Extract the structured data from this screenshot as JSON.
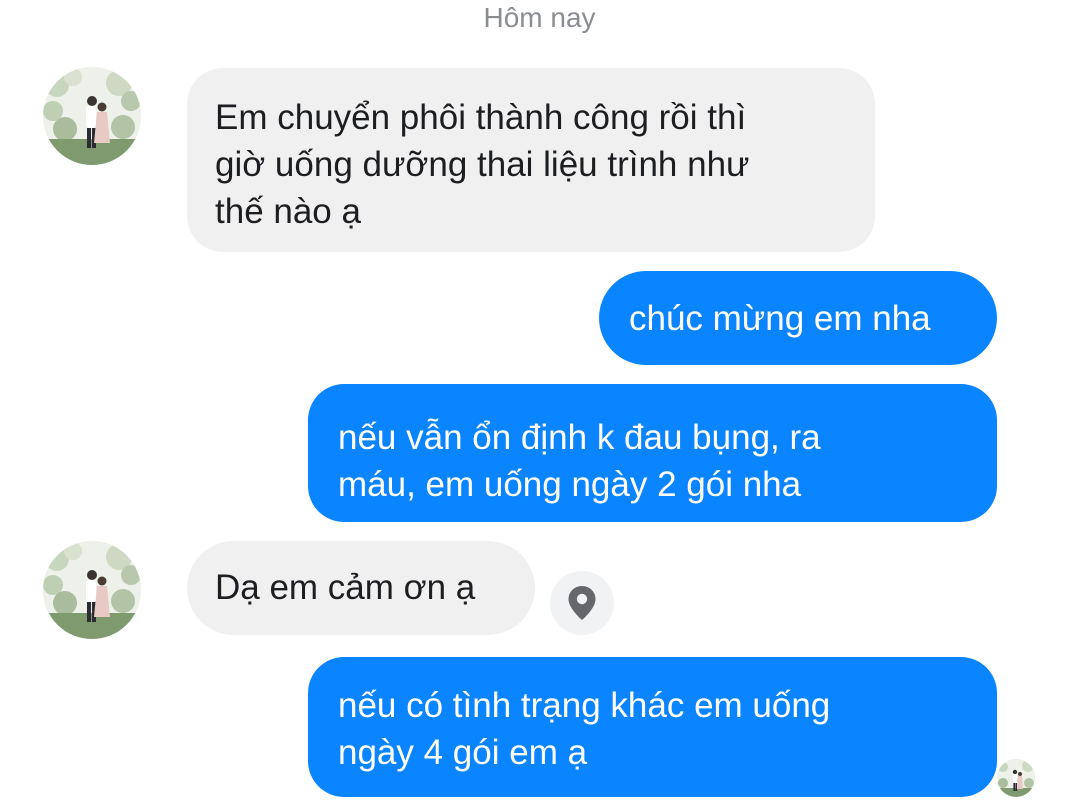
{
  "date_separator": "Hôm nay",
  "messages": [
    {
      "direction": "incoming",
      "text": "Em chuyển phôi thành công rồi thì\ngiờ uống dưỡng thai liệu trình như\nthế nào ạ"
    },
    {
      "direction": "outgoing",
      "text": "chúc mừng em nha"
    },
    {
      "direction": "outgoing",
      "text": "nếu vẫn ổn định k đau bụng, ra\nmáu, em uống ngày 2 gói nha"
    },
    {
      "direction": "incoming",
      "text": "Dạ em cảm ơn ạ"
    },
    {
      "direction": "outgoing",
      "text": "nếu có tình trạng khác em uống\nngày 4 gói em ạ"
    }
  ],
  "icons": {
    "contact_avatar": "avatar-photo-icon",
    "location": "location-pin-icon",
    "seen_indicator": "seen-avatar-icon"
  },
  "colors": {
    "outgoing_bubble": "#0a84ff",
    "incoming_bubble": "#f1f0f0",
    "date_text": "#8a8d91",
    "location_button_bg": "#f1f2f4",
    "location_icon": "#65676b"
  }
}
